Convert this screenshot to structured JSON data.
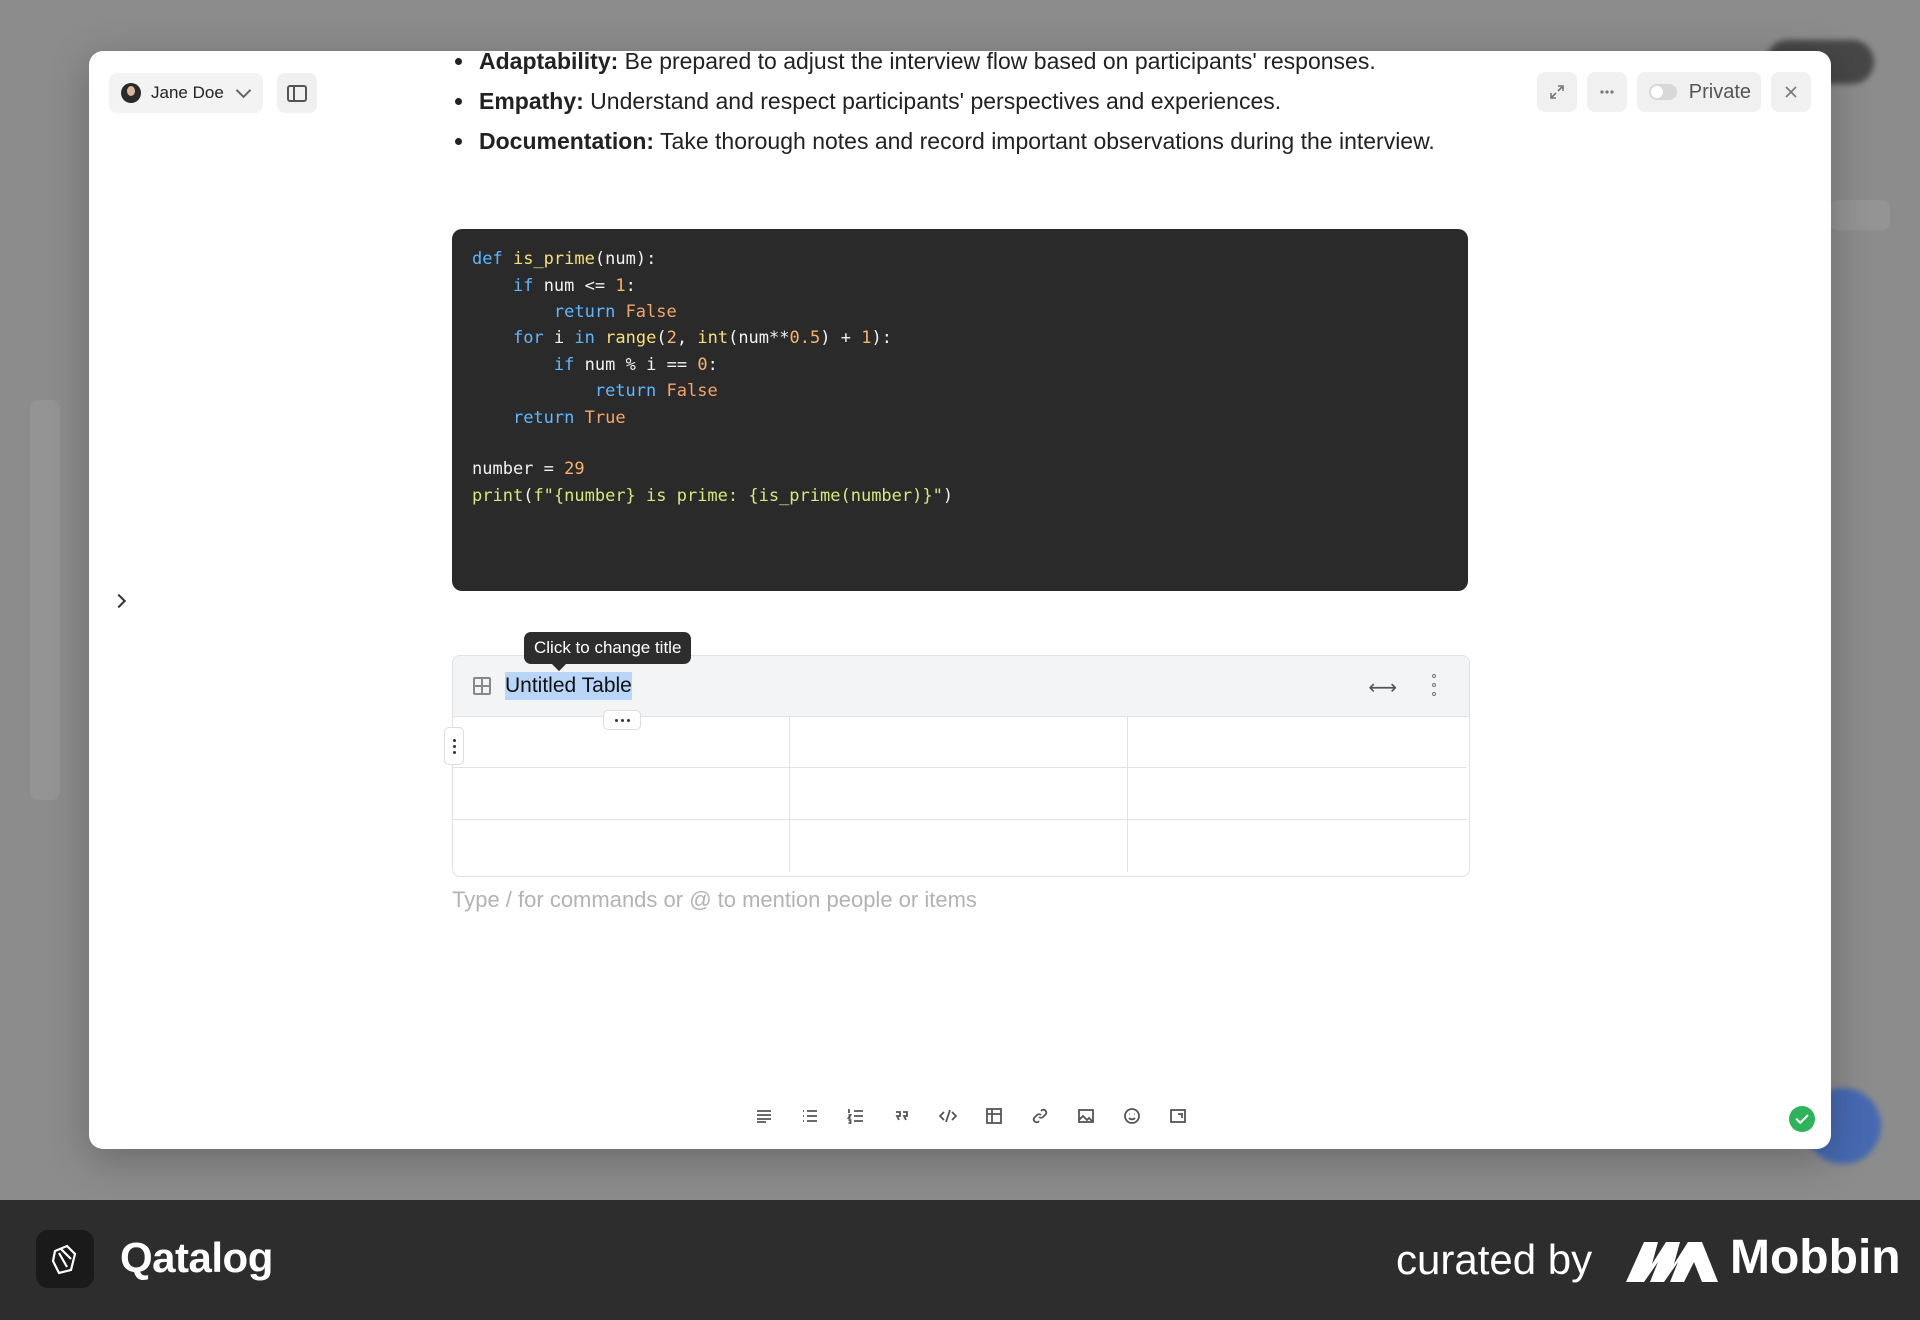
{
  "user": {
    "name": "Jane Doe"
  },
  "header": {
    "private_label": "Private"
  },
  "bullets": [
    {
      "term": "Adaptability:",
      "text": " Be prepared to adjust the interview flow based on participants' responses."
    },
    {
      "term": "Empathy:",
      "text": " Understand and respect participants' perspectives and experiences."
    },
    {
      "term": "Documentation:",
      "text": " Take thorough notes and record important observations during the interview."
    }
  ],
  "code": {
    "lines": [
      "def is_prime(num):",
      "    if num <= 1:",
      "        return False",
      "    for i in range(2, int(num**0.5) + 1):",
      "        if num % i == 0:",
      "            return False",
      "    return True",
      "",
      "number = 29",
      "print(f\"{number} is prime: {is_prime(number)}\")"
    ]
  },
  "table": {
    "tooltip": "Click to change title",
    "title": "Untitled Table",
    "rows": 3,
    "cols": 3
  },
  "editor": {
    "placeholder": "Type / for commands or @ to mention people or items"
  },
  "footer": {
    "app_name": "Qatalog",
    "curated_by": "curated by",
    "curator": "Mobbin"
  },
  "colors": {
    "code_bg": "#2a2a2a",
    "keyword": "#5fb7ff",
    "selection": "#b9d5f7",
    "saved": "#2fb35a"
  },
  "icons": [
    "expand-icon",
    "more-icon",
    "close-icon",
    "sidebar-icon",
    "table-icon",
    "paragraph-icon",
    "bullet-list-icon",
    "numbered-list-icon",
    "quote-icon",
    "code-icon",
    "link-icon",
    "image-icon",
    "emoji-icon",
    "embed-icon"
  ]
}
